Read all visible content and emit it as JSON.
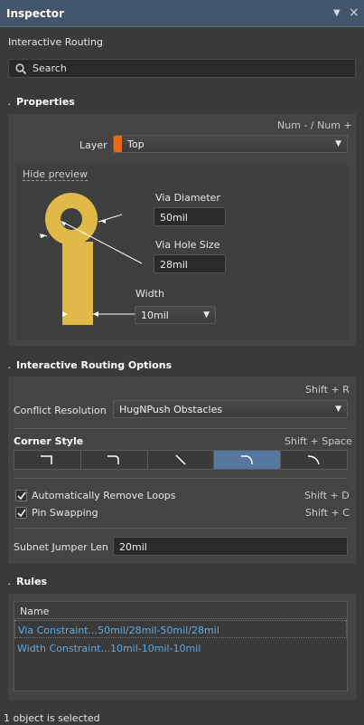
{
  "window": {
    "title": "Inspector"
  },
  "subtitle": "Interactive Routing",
  "search": {
    "placeholder": "Search"
  },
  "properties": {
    "header": "Properties",
    "layer_hint": "Num - / Num +",
    "layer_label": "Layer",
    "layer_value": "Top",
    "layer_color": "#e86a1a",
    "hide_preview": "Hide preview",
    "via_diameter_label": "Via Diameter",
    "via_diameter_value": "50mil",
    "via_hole_label": "Via Hole Size",
    "via_hole_value": "28mil",
    "width_label": "Width",
    "width_value": "10mil",
    "pad_color": "#e0b948"
  },
  "routing_options": {
    "header": "Interactive Routing Options",
    "conflict_hint": "Shift + R",
    "conflict_label": "Conflict Resolution",
    "conflict_value": "HugNPush Obstacles",
    "corner_label": "Corner Style",
    "corner_hint": "Shift + Space",
    "corner_styles": [
      "90 degree",
      "90 degree arc",
      "45 degree",
      "45 degree arc",
      "any angle arc"
    ],
    "corner_selected": 3,
    "auto_remove_loops_label": "Automatically Remove Loops",
    "auto_remove_loops_hint": "Shift + D",
    "auto_remove_loops_checked": true,
    "pin_swapping_label": "Pin Swapping",
    "pin_swapping_hint": "Shift + C",
    "pin_swapping_checked": true,
    "subnet_label": "Subnet Jumper Len",
    "subnet_value": "20mil"
  },
  "rules": {
    "header": "Rules",
    "column_name": "Name",
    "rows": [
      {
        "name": "Via Constraint...50mil/28mil-50mil/28mil"
      },
      {
        "name": "Width Constraint...10mil-10mil-10mil"
      }
    ]
  },
  "status": "1 object is selected",
  "colors": {
    "accent": "#5777a0",
    "link": "#5fa8e6",
    "titlebar": "#41556b"
  }
}
